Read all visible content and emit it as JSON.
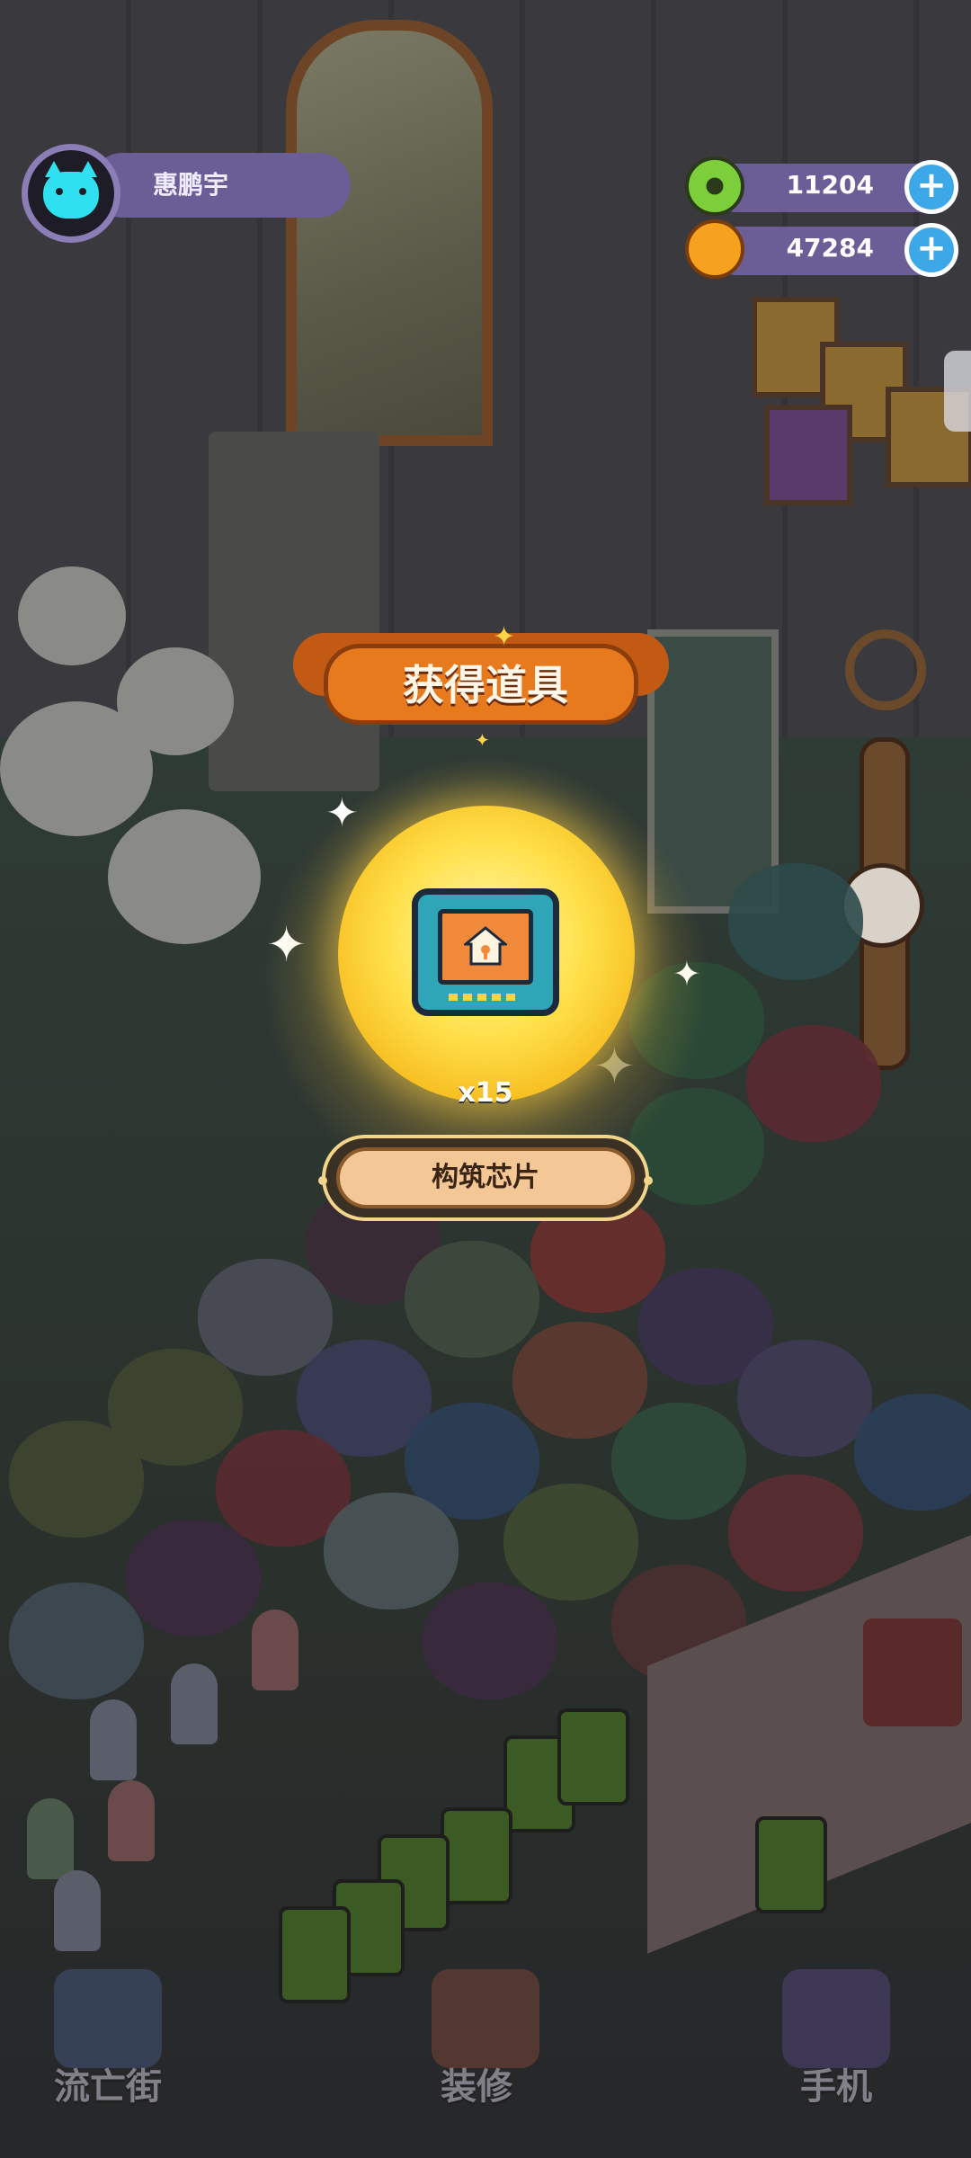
{
  "player": {
    "name": "惠鹏宇"
  },
  "currencies": [
    {
      "icon": "green-donut-coin-icon",
      "value": "11204",
      "color": "#7ccf3a"
    },
    {
      "icon": "orange-planet-coin-icon",
      "value": "47284",
      "color": "#f7a21e"
    }
  ],
  "reward": {
    "title": "获得道具",
    "item_icon": "building-chip-icon",
    "quantity": "x15",
    "item_name": "构筑芯片"
  },
  "nav": [
    {
      "label": "流亡街",
      "icon": "rocket-portal-icon"
    },
    {
      "label": "装修",
      "icon": "hammer-icon"
    },
    {
      "label": "手机",
      "icon": "phone-icon"
    }
  ],
  "colors": {
    "hud_bar": "#6b5d96",
    "banner": "#e87a1e",
    "glow": "#ffe04a",
    "pill": "#f4c896"
  }
}
